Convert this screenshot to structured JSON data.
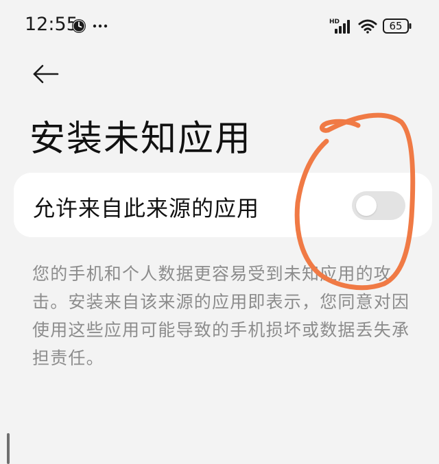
{
  "status_bar": {
    "time": "12:55",
    "battery_level": "65",
    "network_label": "HD",
    "icons": [
      "clock-icon",
      "more-dots-icon",
      "hd-signal-icon",
      "wifi-icon",
      "battery-icon"
    ]
  },
  "navigation": {
    "back_icon": "arrow-left-icon"
  },
  "page": {
    "title": "安装未知应用"
  },
  "setting": {
    "label": "允许来自此来源的应用",
    "toggle_on": false
  },
  "description": "您的手机和个人数据更容易受到未知应用的攻击。安装来自该来源的应用即表示，您同意对因使用这些应用可能导致的手机损坏或数据丢失承担责任。",
  "colors": {
    "background": "#f3f3f3",
    "card": "#ffffff",
    "toggle_off": "#e3e3e3",
    "description_text": "#8c8c8c",
    "annotation_stroke": "#f07a45"
  }
}
